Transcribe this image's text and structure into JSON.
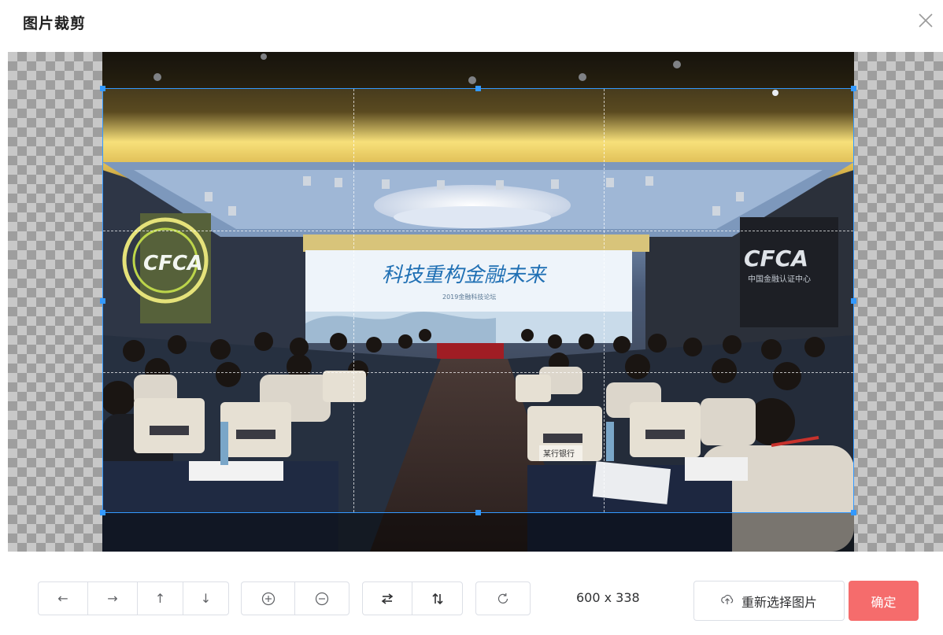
{
  "dialog": {
    "title": "图片裁剪"
  },
  "photo": {
    "screen_banner_text": "科技重构金融未来",
    "screen_subtitle_text": "2019金融科技论坛",
    "left_logo_text": "CFCA",
    "right_logo_text": "CFCA",
    "right_logo_subtext": "中国金融认证中心",
    "front_table_card_text": "某行银行"
  },
  "toolbar": {
    "move_left_label": "←",
    "move_right_label": "→",
    "move_up_label": "↑",
    "move_down_label": "↓",
    "zoom_in_icon": "zoom-in-icon",
    "zoom_out_icon": "zoom-out-icon",
    "flip_horizontal_icon": "flip-horizontal-icon",
    "flip_vertical_icon": "flip-vertical-icon",
    "rotate_icon": "rotate-icon",
    "crop_size": "600 x 338",
    "reselect_label": "重新选择图片",
    "confirm_label": "确定"
  },
  "colors": {
    "accent_blue": "#3399ff",
    "confirm_red": "#f56c6c",
    "border_gray": "#dcdfe6"
  }
}
